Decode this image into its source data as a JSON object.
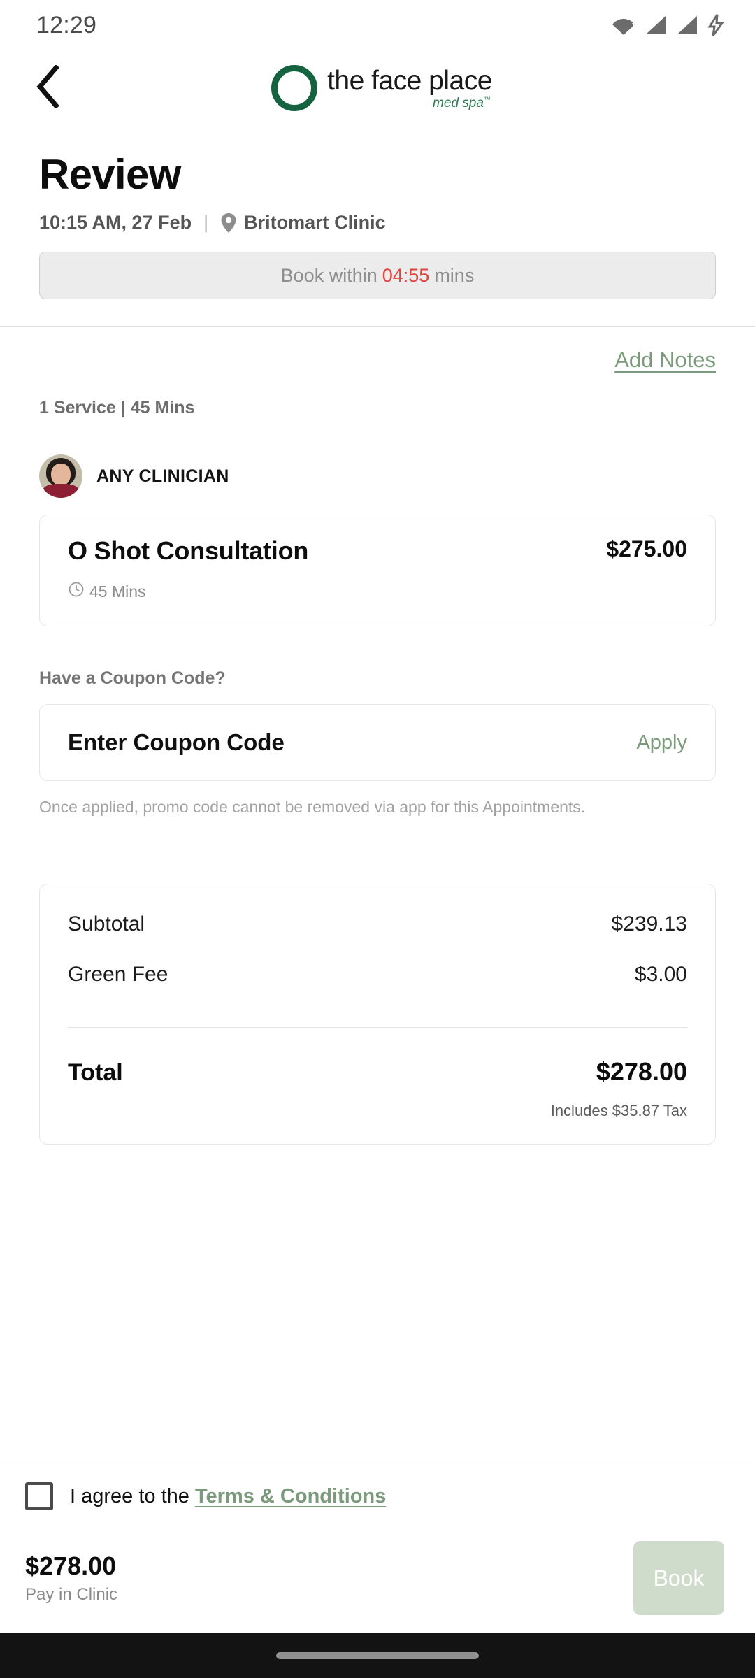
{
  "status_bar": {
    "time": "12:29",
    "icons": [
      "wifi-icon",
      "signal-icon",
      "signal-icon",
      "charging-bolt-icon"
    ]
  },
  "app_bar": {
    "back_icon": "chevron-left-icon",
    "brand_name": "the face place",
    "brand_tagline": "med spa",
    "brand_tm": "™"
  },
  "header": {
    "title": "Review",
    "datetime": "10:15 AM, 27 Feb",
    "separator": "|",
    "location": "Britomart Clinic",
    "location_icon": "map-pin-icon"
  },
  "timer": {
    "prefix": "Book within",
    "countdown": "04:55",
    "suffix": "mins",
    "countdown_color": "#e0453c"
  },
  "notes": {
    "add_notes_label": "Add Notes"
  },
  "summary": {
    "service_count_line": "1 Service | 45 Mins"
  },
  "clinician": {
    "name": "ANY CLINICIAN",
    "avatar": "clinician-avatar"
  },
  "service": {
    "name": "O Shot Consultation",
    "price": "$275.00",
    "duration": "45 Mins",
    "duration_icon": "clock-icon"
  },
  "coupon": {
    "label": "Have a Coupon Code?",
    "placeholder": "Enter Coupon Code",
    "value": "",
    "apply_label": "Apply",
    "note": "Once applied, promo code cannot be removed via app for this Appointments."
  },
  "totals": {
    "rows": [
      {
        "label": "Subtotal",
        "value": "$239.13"
      },
      {
        "label": "Green Fee",
        "value": "$3.00"
      }
    ],
    "total_label": "Total",
    "total_value": "$278.00",
    "tax_note": "Includes $35.87 Tax"
  },
  "footer": {
    "agree_text": "I agree to the ",
    "terms_link": "Terms & Conditions",
    "checkbox_checked": false,
    "pay_amount": "$278.00",
    "pay_method": "Pay in Clinic",
    "book_label": "Book"
  },
  "colors": {
    "brand_green": "#14623f",
    "accent_green": "#7c9a7c",
    "book_button_bg": "#cfdccb",
    "timer_red": "#e0453c"
  }
}
